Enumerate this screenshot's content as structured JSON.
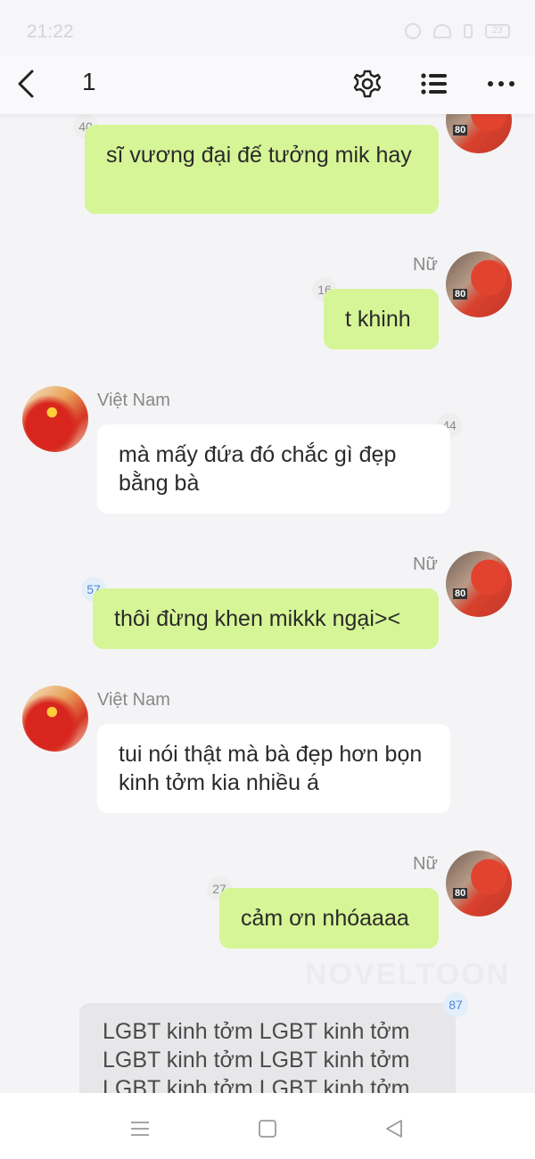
{
  "status_bar": {
    "time": "21:22",
    "battery": "23"
  },
  "header": {
    "title": "1"
  },
  "messages": [
    {
      "name": "",
      "count": "40",
      "text": "sĩ vương đại đế tưởng mik hay"
    },
    {
      "name": "Nữ",
      "count": "16",
      "text": "t khinh"
    },
    {
      "name": "Việt Nam",
      "count": "44",
      "text": "mà mấy đứa đó chắc gì đẹp bằng bà"
    },
    {
      "name": "Nữ",
      "count": "57",
      "text": "thôi đừng khen mikkk ngại><"
    },
    {
      "name": "Việt Nam",
      "count": "",
      "text": "tui nói thật mà bà đẹp hơn bọn kinh tởm kia nhiều á"
    },
    {
      "name": "Nữ",
      "count": "27",
      "text": "cảm ơn nhóaaaa"
    },
    {
      "name": "",
      "count": "87",
      "text": "LGBT kinh tởm LGBT kinh tởm LGBT kinh tởm LGBT kinh tởm LGBT kinh tởm LGBT kinh tởm"
    }
  ],
  "avatar_badge": "80",
  "watermark": "NOVELTOON",
  "colors": {
    "bubble_green": "#d6f596",
    "bubble_white": "#ffffff",
    "bubble_gray": "#e7e7e9",
    "background": "#f4f4f6"
  }
}
